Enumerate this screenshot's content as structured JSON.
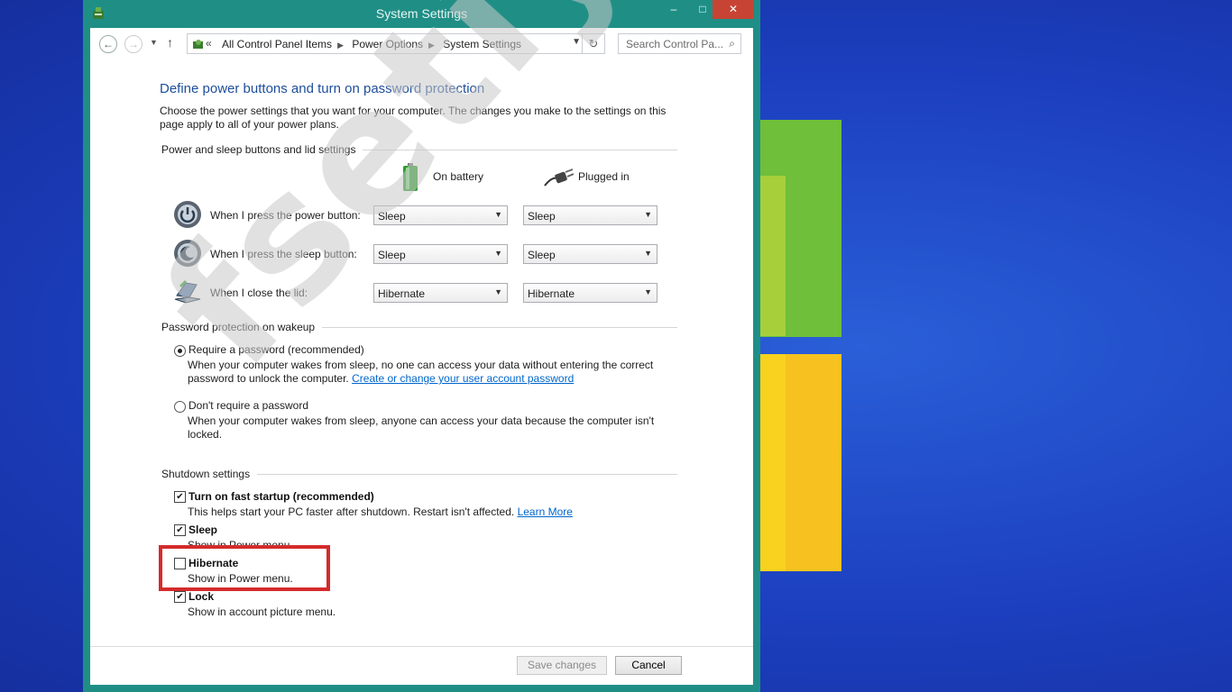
{
  "window": {
    "title": "System Settings",
    "controls": {
      "minimize": "–",
      "maximize": "□",
      "close": "✕"
    }
  },
  "address_bar": {
    "prefix": "«",
    "breadcrumbs": [
      "All Control Panel Items",
      "Power Options",
      "System Settings"
    ],
    "search_placeholder": "Search Control Pa..."
  },
  "page": {
    "heading": "Define power buttons and turn on password protection",
    "description": "Choose the power settings that you want for your computer. The changes you make to the settings on this page apply to all of your power plans."
  },
  "buttons_section": {
    "title": "Power and sleep buttons and lid settings",
    "col_battery": "On battery",
    "col_plugged": "Plugged in",
    "rows": [
      {
        "label": "When I press the power button:",
        "battery": "Sleep",
        "plugged": "Sleep",
        "icon": "power-button-icon"
      },
      {
        "label": "When I press the sleep button:",
        "battery": "Sleep",
        "plugged": "Sleep",
        "icon": "sleep-button-icon"
      },
      {
        "label": "When I close the lid:",
        "battery": "Hibernate",
        "plugged": "Hibernate",
        "icon": "laptop-lid-icon"
      }
    ]
  },
  "password_section": {
    "title": "Password protection on wakeup",
    "require_label": "Require a password (recommended)",
    "require_desc": "When your computer wakes from sleep, no one can access your data without entering the correct password to unlock the computer.",
    "require_link": "Create or change your user account password",
    "norequire_label": "Don't require a password",
    "norequire_desc": "When your computer wakes from sleep, anyone can access your data because the computer isn't locked.",
    "selected": "require"
  },
  "shutdown_section": {
    "title": "Shutdown settings",
    "items": [
      {
        "label": "Turn on fast startup (recommended)",
        "desc": "This helps start your PC faster after shutdown. Restart isn't affected.",
        "link": "Learn More",
        "checked": true
      },
      {
        "label": "Sleep",
        "desc": "Show in Power menu.",
        "checked": true
      },
      {
        "label": "Hibernate",
        "desc": "Show in Power menu.",
        "checked": false
      },
      {
        "label": "Lock",
        "desc": "Show in account picture menu.",
        "checked": true
      }
    ]
  },
  "footer": {
    "save_label": "Save changes",
    "cancel_label": "Cancel"
  },
  "watermark": "fsetiyawan",
  "colors": {
    "title_bar": "#1f8f86",
    "heading": "#1e4e9b",
    "link": "#0066cc",
    "highlight_box": "#d42b2b",
    "close_button": "#c74434"
  }
}
